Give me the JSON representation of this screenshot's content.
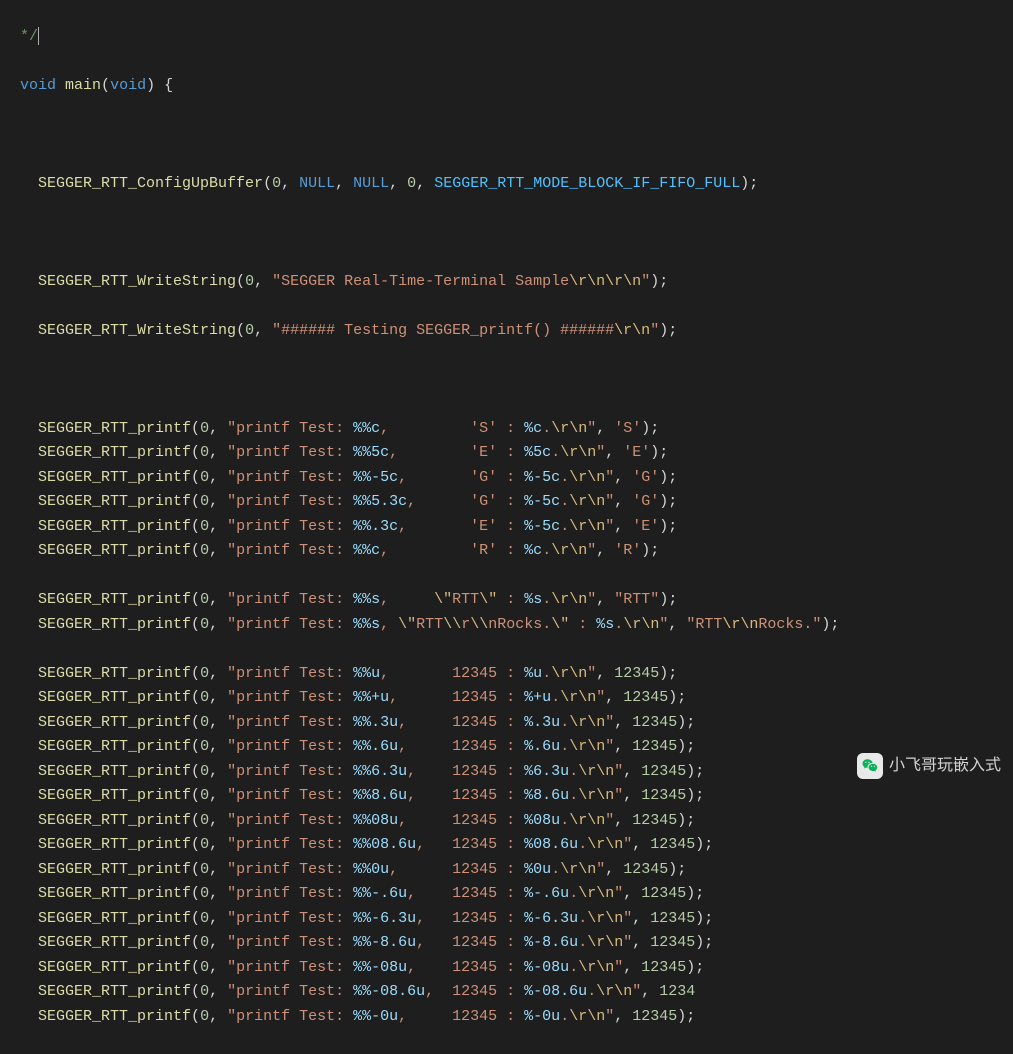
{
  "comment_close": "*/",
  "sig": {
    "void1": "void",
    "main": "main",
    "void2": "void",
    "brace": "{"
  },
  "cfg": {
    "fn": "SEGGER_RTT_ConfigUpBuffer",
    "a0": "0",
    "a1": "NULL",
    "a2": "NULL",
    "a3": "0",
    "a4": "SEGGER_RTT_MODE_BLOCK_IF_FIFO_FULL"
  },
  "ws": {
    "fn": "SEGGER_RTT_WriteString",
    "l1": {
      "a0": "0",
      "s": "\"SEGGER Real-Time-Terminal Sample",
      "e": "\\r\\n\\r\\n",
      "q": "\""
    },
    "l2": {
      "a0": "0",
      "s": "\"###### Testing SEGGER_printf() ######",
      "e": "\\r\\n",
      "q": "\""
    }
  },
  "pf": {
    "fn": "SEGGER_RTT_printf"
  },
  "rows": [
    {
      "a0": "0",
      "pre": "\"printf Test: ",
      "fmt": "%%c",
      "mid": ",         'S' : ",
      "fmt2": "%c",
      "post": ".",
      "e": "\\r\\n",
      "arg": "'S'",
      "argtype": "str"
    },
    {
      "a0": "0",
      "pre": "\"printf Test: ",
      "fmt": "%%5c",
      "mid": ",        'E' : ",
      "fmt2": "%5c",
      "post": ".",
      "e": "\\r\\n",
      "arg": "'E'",
      "argtype": "str"
    },
    {
      "a0": "0",
      "pre": "\"printf Test: ",
      "fmt": "%%-5c",
      "mid": ",       'G' : ",
      "fmt2": "%-5c",
      "post": ".",
      "e": "\\r\\n",
      "arg": "'G'",
      "argtype": "str"
    },
    {
      "a0": "0",
      "pre": "\"printf Test: ",
      "fmt": "%%5.3c",
      "mid": ",      'G' : ",
      "fmt2": "%-5c",
      "post": ".",
      "e": "\\r\\n",
      "arg": "'G'",
      "argtype": "str"
    },
    {
      "a0": "0",
      "pre": "\"printf Test: ",
      "fmt": "%%.3c",
      "mid": ",       'E' : ",
      "fmt2": "%-5c",
      "post": ".",
      "e": "\\r\\n",
      "arg": "'E'",
      "argtype": "str"
    },
    {
      "a0": "0",
      "pre": "\"printf Test: ",
      "fmt": "%%c",
      "mid": ",         'R' : ",
      "fmt2": "%c",
      "post": ".",
      "e": "\\r\\n",
      "arg": "'R'",
      "argtype": "str"
    },
    {
      "blank": true
    },
    {
      "a0": "0",
      "pre": "\"printf Test: ",
      "fmt": "%%s",
      "mid": ",     ",
      "esc1": "\\\"",
      "mid2": "RTT",
      "esc2": "\\\"",
      "mid3": " : ",
      "fmt2": "%s",
      "post": ".",
      "e": "\\r\\n",
      "arg": "\"RTT\"",
      "argtype": "str"
    },
    {
      "a0": "0",
      "pre": "\"printf Test: ",
      "fmt": "%%s",
      "mid": ", ",
      "esc1": "\\\"",
      "mid2": "RTT",
      "esc3": "\\\\",
      "mid4": "r",
      "esc4": "\\\\",
      "mid5": "nRocks.",
      "esc2": "\\\"",
      "mid3": " : ",
      "fmt2": "%s",
      "post": ".",
      "e": "\\r\\n",
      "arg": "\"RTT\\r\\nRocks.\"",
      "argtype": "strEsc"
    },
    {
      "blank": true
    },
    {
      "a0": "0",
      "pre": "\"printf Test: ",
      "fmt": "%%u",
      "mid": ",       12345 : ",
      "fmt2": "%u",
      "post": ".",
      "e": "\\r\\n",
      "arg": "12345",
      "argtype": "num"
    },
    {
      "a0": "0",
      "pre": "\"printf Test: ",
      "fmt": "%%+u",
      "mid": ",      12345 : ",
      "fmt2": "%+u",
      "post": ".",
      "e": "\\r\\n",
      "arg": "12345",
      "argtype": "num"
    },
    {
      "a0": "0",
      "pre": "\"printf Test: ",
      "fmt": "%%.3u",
      "mid": ",     12345 : ",
      "fmt2": "%.3u",
      "post": ".",
      "e": "\\r\\n",
      "arg": "12345",
      "argtype": "num"
    },
    {
      "a0": "0",
      "pre": "\"printf Test: ",
      "fmt": "%%.6u",
      "mid": ",     12345 : ",
      "fmt2": "%.6u",
      "post": ".",
      "e": "\\r\\n",
      "arg": "12345",
      "argtype": "num"
    },
    {
      "a0": "0",
      "pre": "\"printf Test: ",
      "fmt": "%%6.3u",
      "mid": ",    12345 : ",
      "fmt2": "%6.3u",
      "post": ".",
      "e": "\\r\\n",
      "arg": "12345",
      "argtype": "num"
    },
    {
      "a0": "0",
      "pre": "\"printf Test: ",
      "fmt": "%%8.6u",
      "mid": ",    12345 : ",
      "fmt2": "%8.6u",
      "post": ".",
      "e": "\\r\\n",
      "arg": "12345",
      "argtype": "num"
    },
    {
      "a0": "0",
      "pre": "\"printf Test: ",
      "fmt": "%%08u",
      "mid": ",     12345 : ",
      "fmt2": "%08u",
      "post": ".",
      "e": "\\r\\n",
      "arg": "12345",
      "argtype": "num"
    },
    {
      "a0": "0",
      "pre": "\"printf Test: ",
      "fmt": "%%08.6u",
      "mid": ",   12345 : ",
      "fmt2": "%08.6u",
      "post": ".",
      "e": "\\r\\n",
      "arg": "12345",
      "argtype": "num"
    },
    {
      "a0": "0",
      "pre": "\"printf Test: ",
      "fmt": "%%0u",
      "mid": ",      12345 : ",
      "fmt2": "%0u",
      "post": ".",
      "e": "\\r\\n",
      "arg": "12345",
      "argtype": "num"
    },
    {
      "a0": "0",
      "pre": "\"printf Test: ",
      "fmt": "%%-.6u",
      "mid": ",    12345 : ",
      "fmt2": "%-.6u",
      "post": ".",
      "e": "\\r\\n",
      "arg": "12345",
      "argtype": "num"
    },
    {
      "a0": "0",
      "pre": "\"printf Test: ",
      "fmt": "%%-6.3u",
      "mid": ",   12345 : ",
      "fmt2": "%-6.3u",
      "post": ".",
      "e": "\\r\\n",
      "arg": "12345",
      "argtype": "num"
    },
    {
      "a0": "0",
      "pre": "\"printf Test: ",
      "fmt": "%%-8.6u",
      "mid": ",   12345 : ",
      "fmt2": "%-8.6u",
      "post": ".",
      "e": "\\r\\n",
      "arg": "12345",
      "argtype": "num"
    },
    {
      "a0": "0",
      "pre": "\"printf Test: ",
      "fmt": "%%-08u",
      "mid": ",    12345 : ",
      "fmt2": "%-08u",
      "post": ".",
      "e": "\\r\\n",
      "arg": "12345",
      "argtype": "num"
    },
    {
      "a0": "0",
      "pre": "\"printf Test: ",
      "fmt": "%%-08.6u",
      "mid": ",  12345 : ",
      "fmt2": "%-08.6u",
      "post": ".",
      "e": "\\r\\n",
      "arg": "1234",
      "argtype": "num",
      "truncated": true
    },
    {
      "a0": "0",
      "pre": "\"printf Test: ",
      "fmt": "%%-0u",
      "mid": ",     12345 : ",
      "fmt2": "%-0u",
      "post": ".",
      "e": "\\r\\n",
      "arg": "12345",
      "argtype": "num"
    }
  ],
  "watermark": "小飞哥玩嵌入式"
}
